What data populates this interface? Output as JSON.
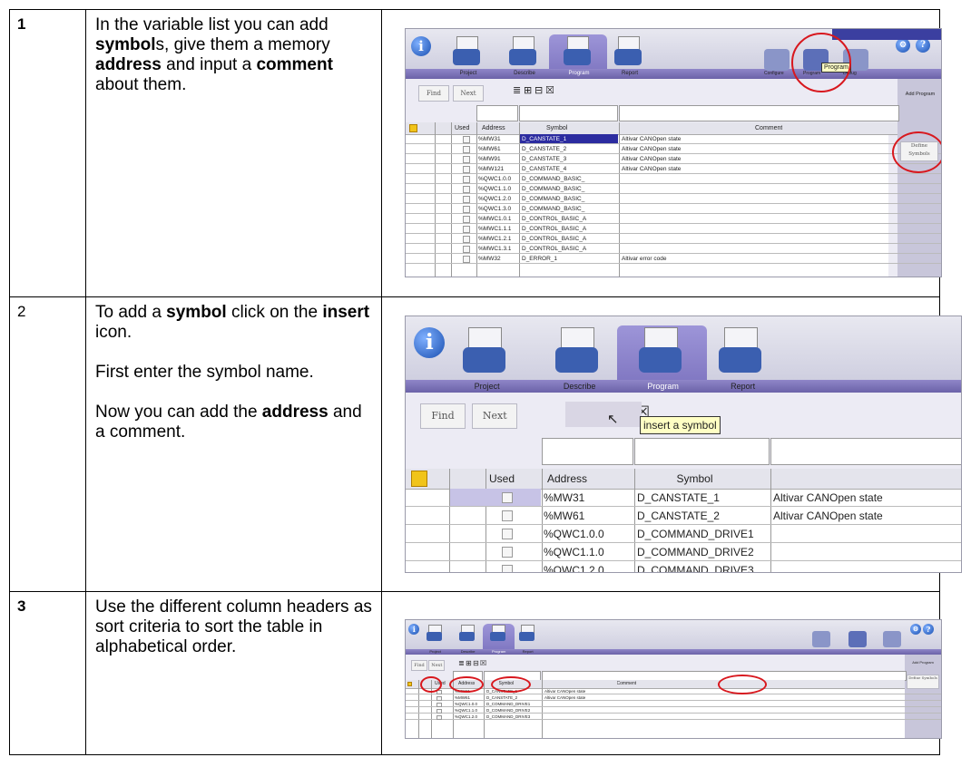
{
  "rows": [
    {
      "number": "1",
      "text_html": "In the variable list you can add <b>symbol</b>s, give them a memory <b>address</b> and input a <b>comment</b> about them."
    },
    {
      "number": "2",
      "text_html": "<p>To add a <b>symbol</b> click on the <b>insert</b> icon.</p><p>First enter the symbol name.</p><p>Now you can add the <b>address</b> and a comment.</p>"
    },
    {
      "number": "3",
      "text_html": "Use the different column headers as sort criteria to sort the table in alphabetical order."
    }
  ],
  "screens": {
    "tabs": [
      "Project",
      "Describe",
      "Program",
      "Report"
    ],
    "find": "Find",
    "next": "Next",
    "headers": {
      "used": "Used",
      "address": "Address",
      "symbol": "Symbol",
      "comment": "Comment"
    },
    "s1": {
      "tooltip": "Program",
      "right_top": "Add Program",
      "right_btn": "Define Symbols",
      "config_labels": [
        "Configure",
        "Program",
        "Debug"
      ],
      "addresses": [
        "%MW31",
        "%MW61",
        "%MW91",
        "%MW121",
        "%QWC1.0.0",
        "%QWC1.1.0",
        "%QWC1.2.0",
        "%QWC1.3.0",
        "%MWC1.0.1",
        "%MWC1.1.1",
        "%MWC1.2.1",
        "%MWC1.3.1",
        "%MW32"
      ],
      "symbols": [
        "D_CANSTATE_1",
        "D_CANSTATE_2",
        "D_CANSTATE_3",
        "D_CANSTATE_4",
        "D_COMMAND_BASIC_",
        "D_COMMAND_BASIC_",
        "D_COMMAND_BASIC_",
        "D_COMMAND_BASIC_",
        "D_CONTROL_BASIC_A",
        "D_CONTROL_BASIC_A",
        "D_CONTROL_BASIC_A",
        "D_CONTROL_BASIC_A",
        "D_ERROR_1"
      ],
      "comments": [
        "Altivar CANOpen state",
        "Altivar CANOpen state",
        "Altivar CANOpen state",
        "Altivar CANOpen state",
        "",
        "",
        "",
        "",
        "",
        "",
        "",
        "",
        "Altivar error code"
      ]
    },
    "s2": {
      "tooltip": "insert a symbol",
      "addresses": [
        "%MW31",
        "%MW61",
        "%QWC1.0.0",
        "%QWC1.1.0",
        "%QWC1.2.0"
      ],
      "symbols": [
        "D_CANSTATE_1",
        "D_CANSTATE_2",
        "D_COMMAND_DRIVE1",
        "D_COMMAND_DRIVE2",
        "D_COMMAND_DRIVE3"
      ],
      "comments": [
        "Altivar CANOpen state",
        "Altivar CANOpen state",
        "",
        "",
        ""
      ]
    },
    "s3": {
      "right_top": "Add Program",
      "right_btn": "Define Symbols",
      "addresses": [
        "%MW31",
        "%MW61",
        "%QWC1.0.0",
        "%QWC1.1.0",
        "%QWC1.2.0"
      ],
      "symbols": [
        "D_CANSTATE_1",
        "D_CANSTATE_2",
        "D_COMMAND_DRIVE1",
        "D_COMMAND_DRIVE2",
        "D_COMMAND_DRIVE3"
      ],
      "comments": [
        "Altivar CANOpen state",
        "Altivar CANOpen state",
        "",
        "",
        ""
      ]
    }
  },
  "accent": {
    "purple": "#7b72be",
    "red_circle": "#d8181e",
    "tooltip_bg": "#ffffc4",
    "info_blue": "#1a4fb0"
  }
}
